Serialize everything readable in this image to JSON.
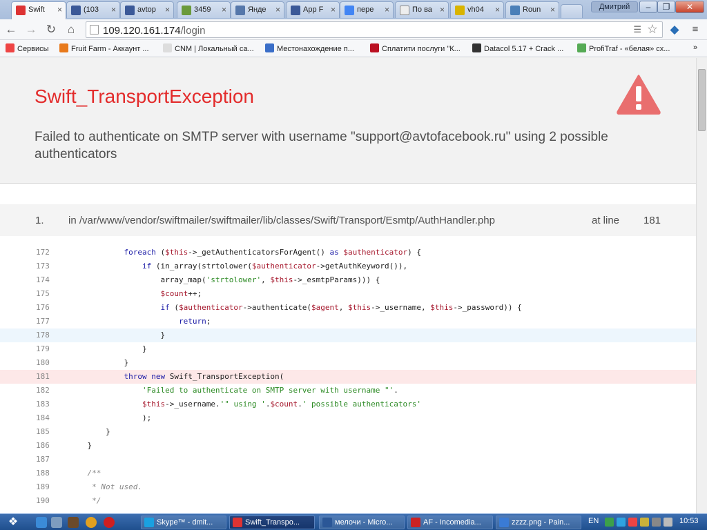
{
  "browser": {
    "tabs": [
      {
        "label": "Swift",
        "favicon": "error-page-icon",
        "active": true
      },
      {
        "label": "(103",
        "favicon": "facebook-icon"
      },
      {
        "label": "avtop",
        "favicon": "facebook-icon"
      },
      {
        "label": "3459",
        "favicon": "image-icon"
      },
      {
        "label": "Янде",
        "favicon": "yandex-icon"
      },
      {
        "label": "App F",
        "favicon": "facebook-icon"
      },
      {
        "label": "пере",
        "favicon": "google-icon"
      },
      {
        "label": "По ва",
        "favicon": "document-icon"
      },
      {
        "label": "vh04",
        "favicon": "home-icon"
      },
      {
        "label": "Roun",
        "favicon": "roundcube-icon"
      }
    ],
    "user_name": "Дмитрий",
    "url_host": "109.120.161.174",
    "url_path": "/login",
    "bookmarks": [
      {
        "label": "Сервисы",
        "color": "#e44"
      },
      {
        "label": "Fruit Farm - Аккаунт ...",
        "color": "#e87a1c"
      },
      {
        "label": "CNM | Локальный са...",
        "color": "#ddd"
      },
      {
        "label": "Местонахождение п...",
        "color": "#3a6ec8"
      },
      {
        "label": "Сплатити послуги \"К...",
        "color": "#b12"
      },
      {
        "label": "Datacol 5.17 + Crack ...",
        "color": "#333"
      },
      {
        "label": "ProfiTraf - «белая» сх...",
        "color": "#5a5"
      }
    ]
  },
  "error": {
    "title": "Swift_TransportException",
    "message": "Failed to authenticate on SMTP server with username \"support@avtofacebook.ru\" using 2 possible authenticators",
    "trace_index": "1.",
    "trace_file": "in /var/www/vendor/swiftmailer/swiftmailer/lib/classes/Swift/Transport/Esmtp/AuthHandler.php",
    "trace_at": "at line",
    "trace_line": "181",
    "colors": {
      "title": "#e32b2b",
      "warning": "#e96e6e",
      "line_highlight": "#fde8e8",
      "hover_highlight": "#edf6fd"
    }
  },
  "code_lines": [
    {
      "num": "172",
      "text": "            foreach ($this->_getAuthenticatorsForAgent() as $authenticator) {"
    },
    {
      "num": "173",
      "text": "                if (in_array(strtolower($authenticator->getAuthKeyword()),"
    },
    {
      "num": "174",
      "text": "                    array_map('strtolower', $this->_esmtpParams))) {"
    },
    {
      "num": "175",
      "text": "                    $count++;"
    },
    {
      "num": "176",
      "text": "                    if ($authenticator->authenticate($agent, $this->_username, $this->_password)) {"
    },
    {
      "num": "177",
      "text": "                        return;"
    },
    {
      "num": "178",
      "text": "                    }"
    },
    {
      "num": "179",
      "text": "                }"
    },
    {
      "num": "180",
      "text": "            }"
    },
    {
      "num": "181",
      "text": "            throw new Swift_TransportException("
    },
    {
      "num": "182",
      "text": "                'Failed to authenticate on SMTP server with username \"'."
    },
    {
      "num": "183",
      "text": "                $this->_username.'\" using '.$count.' possible authenticators'"
    },
    {
      "num": "184",
      "text": "                );"
    },
    {
      "num": "185",
      "text": "        }"
    },
    {
      "num": "186",
      "text": "    }"
    },
    {
      "num": "187",
      "text": ""
    },
    {
      "num": "188",
      "text": "    /**"
    },
    {
      "num": "189",
      "text": "     * Not used."
    },
    {
      "num": "190",
      "text": "     */"
    }
  ],
  "taskbar": {
    "tasks": [
      {
        "label": "Skype™ - dmit...",
        "color": "#1aa1e1"
      },
      {
        "label": "Swift_Transpo...",
        "color": "#d33",
        "active": true
      },
      {
        "label": "мелочи - Micro...",
        "color": "#2b5797"
      },
      {
        "label": "AF - Incomedia...",
        "color": "#c22"
      },
      {
        "label": "zzzz.png - Pain...",
        "color": "#3a7bd5"
      }
    ],
    "language": "EN",
    "time": "10:53"
  }
}
